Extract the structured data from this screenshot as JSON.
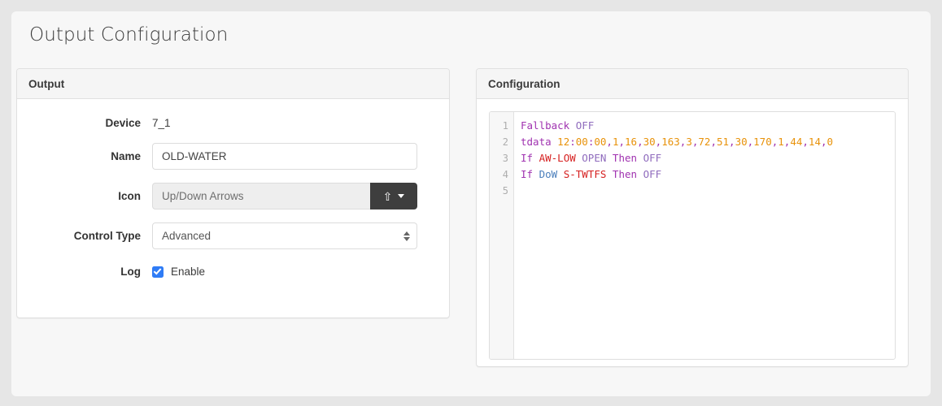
{
  "page": {
    "title": "Output Configuration"
  },
  "output_panel": {
    "header": "Output",
    "fields": {
      "device": {
        "label": "Device",
        "value": "7_1"
      },
      "name": {
        "label": "Name",
        "value": "OLD-WATER",
        "placeholder": ""
      },
      "icon": {
        "label": "Icon",
        "value": "Up/Down Arrows",
        "dropdown_glyph": "⇧",
        "dropdown_icon": "up-arrow-icon",
        "caret_icon": "caret-down-icon"
      },
      "control_type": {
        "label": "Control Type",
        "value": "Advanced",
        "options": [
          "Advanced"
        ]
      },
      "log": {
        "label": "Log",
        "checkbox_label": "Enable",
        "checked": true
      }
    }
  },
  "configuration_panel": {
    "header": "Configuration",
    "editor": {
      "line_numbers": [
        "1",
        "2",
        "3",
        "4",
        "5"
      ],
      "lines": [
        [
          {
            "t": "Fallback",
            "c": "tok-keyword"
          },
          {
            "t": " ",
            "c": "tok-plain"
          },
          {
            "t": "OFF",
            "c": "tok-soft"
          }
        ],
        [
          {
            "t": "tdata",
            "c": "tok-keyword"
          },
          {
            "t": " ",
            "c": "tok-plain"
          },
          {
            "t": "12",
            "c": "tok-number"
          },
          {
            "t": ":",
            "c": "tok-punct"
          },
          {
            "t": "00",
            "c": "tok-number"
          },
          {
            "t": ":",
            "c": "tok-punct"
          },
          {
            "t": "00",
            "c": "tok-number"
          },
          {
            "t": ",",
            "c": "tok-punct"
          },
          {
            "t": "1",
            "c": "tok-number"
          },
          {
            "t": ",",
            "c": "tok-punct"
          },
          {
            "t": "16",
            "c": "tok-number"
          },
          {
            "t": ",",
            "c": "tok-punct"
          },
          {
            "t": "30",
            "c": "tok-number"
          },
          {
            "t": ",",
            "c": "tok-punct"
          },
          {
            "t": "163",
            "c": "tok-number"
          },
          {
            "t": ",",
            "c": "tok-punct"
          },
          {
            "t": "3",
            "c": "tok-number"
          },
          {
            "t": ",",
            "c": "tok-punct"
          },
          {
            "t": "72",
            "c": "tok-number"
          },
          {
            "t": ",",
            "c": "tok-punct"
          },
          {
            "t": "51",
            "c": "tok-number"
          },
          {
            "t": ",",
            "c": "tok-punct"
          },
          {
            "t": "30",
            "c": "tok-number"
          },
          {
            "t": ",",
            "c": "tok-punct"
          },
          {
            "t": "170",
            "c": "tok-number"
          },
          {
            "t": ",",
            "c": "tok-punct"
          },
          {
            "t": "1",
            "c": "tok-number"
          },
          {
            "t": ",",
            "c": "tok-punct"
          },
          {
            "t": "44",
            "c": "tok-number"
          },
          {
            "t": ",",
            "c": "tok-punct"
          },
          {
            "t": "14",
            "c": "tok-number"
          },
          {
            "t": ",",
            "c": "tok-punct"
          },
          {
            "t": "0",
            "c": "tok-number"
          }
        ],
        [
          {
            "t": "If",
            "c": "tok-keyword"
          },
          {
            "t": " ",
            "c": "tok-plain"
          },
          {
            "t": "AW-LOW",
            "c": "tok-red"
          },
          {
            "t": " ",
            "c": "tok-plain"
          },
          {
            "t": "OPEN",
            "c": "tok-soft"
          },
          {
            "t": " ",
            "c": "tok-plain"
          },
          {
            "t": "Then",
            "c": "tok-keyword"
          },
          {
            "t": " ",
            "c": "tok-plain"
          },
          {
            "t": "OFF",
            "c": "tok-soft"
          }
        ],
        [
          {
            "t": "If",
            "c": "tok-keyword"
          },
          {
            "t": " ",
            "c": "tok-plain"
          },
          {
            "t": "DoW",
            "c": "tok-blue"
          },
          {
            "t": " ",
            "c": "tok-plain"
          },
          {
            "t": "S-TWTFS",
            "c": "tok-red"
          },
          {
            "t": " ",
            "c": "tok-plain"
          },
          {
            "t": "Then",
            "c": "tok-keyword"
          },
          {
            "t": " ",
            "c": "tok-plain"
          },
          {
            "t": "OFF",
            "c": "tok-soft"
          }
        ],
        []
      ],
      "plain_text": "Fallback OFF\ntdata 12:00:00,1,16,30,163,3,72,51,30,170,1,44,14,0\nIf AW-LOW OPEN Then OFF\nIf DoW S-TWTFS Then OFF\n"
    }
  },
  "colors": {
    "page_background": "#e6e6e6",
    "card_background": "#f7f7f7",
    "panel_header": "#f5f5f5",
    "checkbox_accent": "#2f7cf6",
    "dropdown_button": "#3e3e3e",
    "syntax_keyword": "#a032b0",
    "syntax_soft": "#8f6bbd",
    "syntax_number": "#e8920a",
    "syntax_red": "#d62020",
    "syntax_blue": "#4a7ebb"
  }
}
